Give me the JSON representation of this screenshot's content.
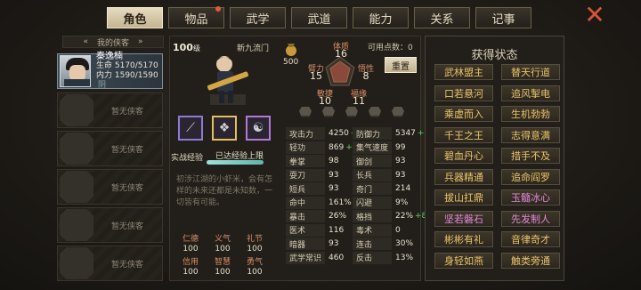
{
  "tabs": [
    "角色",
    "物品",
    "武学",
    "武道",
    "能力",
    "关系",
    "记事"
  ],
  "left": {
    "header": "我的侠客",
    "char": {
      "name": "秦逸楠",
      "hp": "生命 5170/5170",
      "mp": "内力 1590/1590",
      "tag": "阴"
    },
    "empty": "暂无侠客"
  },
  "profile": {
    "level": "100",
    "level_unit": "级",
    "school": "新九流门",
    "medal_value": "500",
    "free_points_label": "可用点数：0",
    "reset": "重置",
    "exp_label": "实战经验",
    "exp_full": "已达经验上限",
    "exp_fraction": 1.0,
    "desc": "初涉江湖的小虾米，会有怎样的未来还都是未知数，一切皆有可能。"
  },
  "attributes": {
    "tizhi": {
      "label": "体质",
      "value": "16"
    },
    "biili": {
      "label": "臂力",
      "value": "15"
    },
    "wuxing": {
      "label": "悟性",
      "value": "8"
    },
    "minjie": {
      "label": "敏捷",
      "value": "10"
    },
    "fuyuan": {
      "label": "福缘",
      "value": "11"
    }
  },
  "virtues": [
    {
      "l": "仁德",
      "v": "100"
    },
    {
      "l": "义气",
      "v": "100"
    },
    {
      "l": "礼节",
      "v": "100"
    },
    {
      "l": "信用",
      "v": "100"
    },
    {
      "l": "智慧",
      "v": "100"
    },
    {
      "l": "勇气",
      "v": "100"
    }
  ],
  "stats": {
    "atk": {
      "k": "攻击力",
      "v": "4250",
      "b": "+541"
    },
    "def": {
      "k": "防御力",
      "v": "5347",
      "b": "+1354"
    },
    "qinggong": {
      "k": "轻功",
      "v": "869",
      "b": "+235"
    },
    "speed": {
      "k": "集气速度",
      "v": "99",
      "b": ""
    },
    "quanzhang": {
      "k": "拳掌",
      "v": "98",
      "b": ""
    },
    "yujian": {
      "k": "御剑",
      "v": "93",
      "b": ""
    },
    "shuadao": {
      "k": "耍刀",
      "v": "93",
      "b": ""
    },
    "changbing": {
      "k": "长兵",
      "v": "93",
      "b": ""
    },
    "duanbing": {
      "k": "短兵",
      "v": "93",
      "b": ""
    },
    "qimen": {
      "k": "奇门",
      "v": "214",
      "b": ""
    },
    "mingzhong": {
      "k": "命中",
      "v": "161%",
      "b": ""
    },
    "shanbi": {
      "k": "闪避",
      "v": "9%",
      "b": ""
    },
    "baoji": {
      "k": "暴击",
      "v": "26%",
      "b": ""
    },
    "gedang": {
      "k": "格挡",
      "v": "22%",
      "b": "+8%"
    },
    "yishu": {
      "k": "医术",
      "v": "116",
      "b": ""
    },
    "dushu": {
      "k": "毒术",
      "v": "0",
      "b": ""
    },
    "anqi": {
      "k": "暗器",
      "v": "93",
      "b": ""
    },
    "lianji": {
      "k": "连击",
      "v": "30%",
      "b": ""
    },
    "wuxue": {
      "k": "武学常识",
      "v": "460",
      "b": ""
    },
    "fanji": {
      "k": "反击",
      "v": "13%",
      "b": ""
    }
  },
  "buffs": {
    "title": "获得状态",
    "items": [
      "武林盟主",
      "替天行道",
      "口若悬河",
      "追风掣电",
      "乘虚而入",
      "生机勃勃",
      "千王之王",
      "志得意满",
      "碧血丹心",
      "措手不及",
      "兵器精通",
      "追命阎罗",
      "拔山扛鼎",
      "玉髓冰心",
      "坚若磐石",
      "先发制人",
      "彬彬有礼",
      "音律奇才",
      "身轻如燕",
      "触类旁通"
    ],
    "colors": [
      "#e9c46a",
      "#e9c46a",
      "#e9c46a",
      "#e9c46a",
      "#e9c46a",
      "#e9c46a",
      "#e9c46a",
      "#e9c46a",
      "#e9c46a",
      "#e9c46a",
      "#e9c46a",
      "#e9c46a",
      "#e9c46a",
      "#e48ad6",
      "#e48ad6",
      "#e48ad6",
      "#e9c46a",
      "#e9c46a",
      "#e9c46a",
      "#e9c46a"
    ]
  }
}
